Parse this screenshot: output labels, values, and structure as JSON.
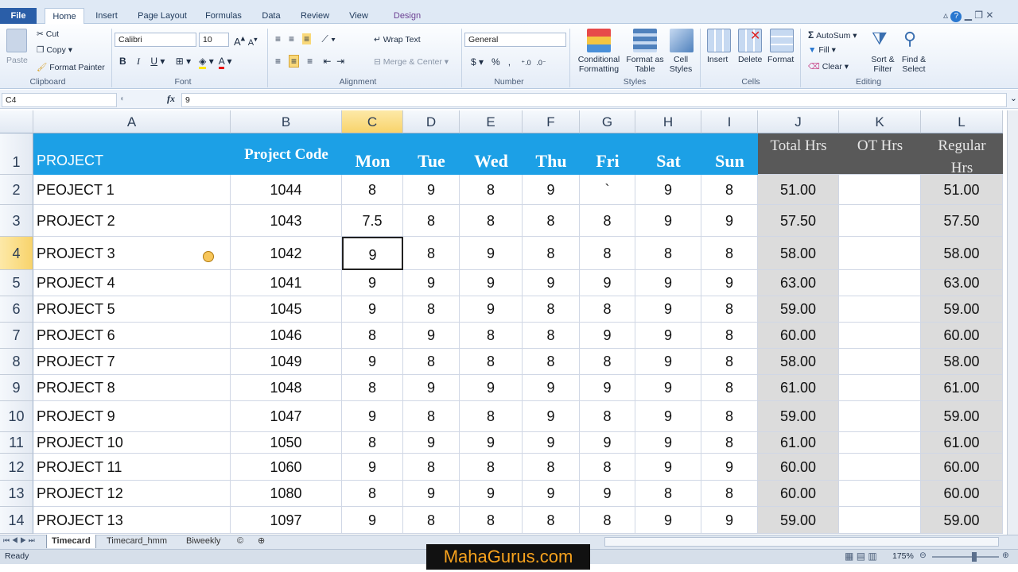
{
  "ribbon": {
    "tabs": [
      "File",
      "Home",
      "Insert",
      "Page Layout",
      "Formulas",
      "Data",
      "Review",
      "View",
      "Design"
    ],
    "clipboard": {
      "paste": "Paste",
      "cut": "Cut",
      "copy": "Copy",
      "format_painter": "Format Painter",
      "label": "Clipboard"
    },
    "font": {
      "name": "Calibri",
      "size": "10",
      "label": "Font"
    },
    "alignment": {
      "wrap": "Wrap Text",
      "merge": "Merge & Center",
      "label": "Alignment"
    },
    "number": {
      "format": "General",
      "dollar": "$",
      "percent": "%",
      "comma": ",",
      "label": "Number"
    },
    "styles": {
      "conditional": "Conditional Formatting",
      "format_table": "Format as Table",
      "cell_styles": "Cell Styles",
      "label": "Styles"
    },
    "cells": {
      "insert": "Insert",
      "delete": "Delete",
      "format": "Format",
      "label": "Cells"
    },
    "editing": {
      "autosum": "AutoSum",
      "fill": "Fill",
      "clear": "Clear",
      "sort": "Sort & Filter",
      "find": "Find & Select",
      "label": "Editing"
    }
  },
  "formula_bar": {
    "name_box": "C4",
    "fx": "fx",
    "value": "9"
  },
  "columns": [
    "A",
    "B",
    "C",
    "D",
    "E",
    "F",
    "G",
    "H",
    "I",
    "J",
    "K",
    "L"
  ],
  "header_row": {
    "project": "PROJECT",
    "code": "Project Code",
    "days": [
      "Mon",
      "Tue",
      "Wed",
      "Thu",
      "Fri",
      "Sat",
      "Sun"
    ],
    "total": "Total Hrs",
    "ot": "OT Hrs",
    "regular": "Regular Hrs"
  },
  "rows": [
    {
      "n": "2",
      "p": "PEOJECT 1",
      "c": "1044",
      "d": [
        "8",
        "9",
        "8",
        "9",
        "`",
        "9",
        "8"
      ],
      "t": "51.00",
      "o": "",
      "r": "51.00"
    },
    {
      "n": "3",
      "p": "PROJECT 2",
      "c": "1043",
      "d": [
        "7.5",
        "8",
        "8",
        "8",
        "8",
        "9",
        "9"
      ],
      "t": "57.50",
      "o": "",
      "r": "57.50"
    },
    {
      "n": "4",
      "p": "PROJECT 3",
      "c": "1042",
      "d": [
        "9",
        "8",
        "9",
        "8",
        "8",
        "8",
        "8"
      ],
      "t": "58.00",
      "o": "",
      "r": "58.00"
    },
    {
      "n": "5",
      "p": "PROJECT 4",
      "c": "1041",
      "d": [
        "9",
        "9",
        "9",
        "9",
        "9",
        "9",
        "9"
      ],
      "t": "63.00",
      "o": "",
      "r": "63.00"
    },
    {
      "n": "6",
      "p": "PROJECT 5",
      "c": "1045",
      "d": [
        "9",
        "8",
        "9",
        "8",
        "8",
        "9",
        "8"
      ],
      "t": "59.00",
      "o": "",
      "r": "59.00"
    },
    {
      "n": "7",
      "p": "PROJECT 6",
      "c": "1046",
      "d": [
        "8",
        "9",
        "8",
        "8",
        "9",
        "9",
        "8"
      ],
      "t": "60.00",
      "o": "",
      "r": "60.00"
    },
    {
      "n": "8",
      "p": "PROJECT 7",
      "c": "1049",
      "d": [
        "9",
        "8",
        "8",
        "8",
        "8",
        "9",
        "8"
      ],
      "t": "58.00",
      "o": "",
      "r": "58.00"
    },
    {
      "n": "9",
      "p": "PROJECT 8",
      "c": "1048",
      "d": [
        "8",
        "9",
        "9",
        "9",
        "9",
        "9",
        "8"
      ],
      "t": "61.00",
      "o": "",
      "r": "61.00"
    },
    {
      "n": "10",
      "p": "PROJECT 9",
      "c": "1047",
      "d": [
        "9",
        "8",
        "8",
        "9",
        "8",
        "9",
        "8"
      ],
      "t": "59.00",
      "o": "",
      "r": "59.00"
    },
    {
      "n": "11",
      "p": "PROJECT 10",
      "c": "1050",
      "d": [
        "8",
        "9",
        "9",
        "9",
        "9",
        "9",
        "8"
      ],
      "t": "61.00",
      "o": "",
      "r": "61.00"
    },
    {
      "n": "12",
      "p": "PROJECT 11",
      "c": "1060",
      "d": [
        "9",
        "8",
        "8",
        "8",
        "8",
        "9",
        "9"
      ],
      "t": "60.00",
      "o": "",
      "r": "60.00"
    },
    {
      "n": "13",
      "p": "PROJECT 12",
      "c": "1080",
      "d": [
        "8",
        "9",
        "9",
        "9",
        "9",
        "8",
        "8"
      ],
      "t": "60.00",
      "o": "",
      "r": "60.00"
    },
    {
      "n": "14",
      "p": "PROJECT 13",
      "c": "1097",
      "d": [
        "9",
        "8",
        "8",
        "8",
        "8",
        "9",
        "9"
      ],
      "t": "59.00",
      "o": "",
      "r": "59.00"
    }
  ],
  "sheets": [
    "Timecard",
    "Timecard_hmm",
    "Biweekly"
  ],
  "status": {
    "ready": "Ready",
    "zoom": "175%"
  },
  "watermark": "MahaGurus.com",
  "colors": {
    "header_blue": "#1ca0e6",
    "header_gray": "#595959",
    "total_gray": "#dcdcdc",
    "selection": "#f8d36b"
  }
}
